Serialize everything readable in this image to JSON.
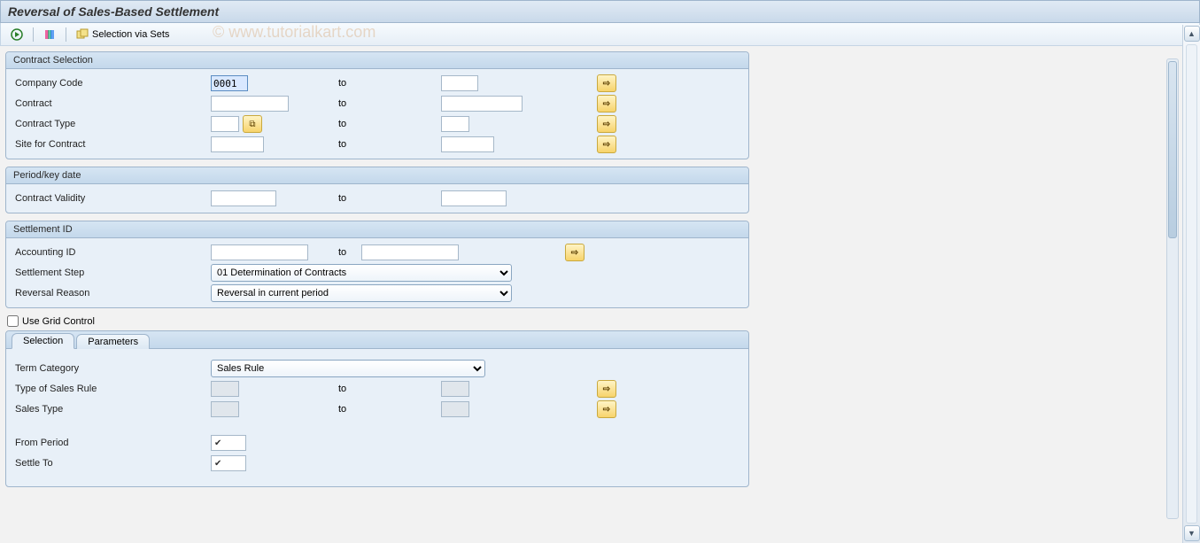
{
  "title": "Reversal of Sales-Based Settlement",
  "toolbar": {
    "execute_tip": "Execute",
    "variant_tip": "Get Variant",
    "selection_via_sets_label": "Selection via Sets"
  },
  "watermark": "© www.tutorialkart.com",
  "groups": {
    "contract_selection": {
      "title": "Contract Selection",
      "company_code_label": "Company Code",
      "company_code_from": "0001",
      "company_code_to": "",
      "contract_label": "Contract",
      "contract_from": "",
      "contract_to": "",
      "contract_type_label": "Contract Type",
      "contract_type_from": "",
      "contract_type_to": "",
      "site_label": "Site for Contract",
      "site_from": "",
      "site_to": "",
      "to_label": "to"
    },
    "period": {
      "title": "Period/key date",
      "contract_validity_label": "Contract Validity",
      "contract_validity_from": "",
      "contract_validity_to": "",
      "to_label": "to"
    },
    "settlement_id": {
      "title": "Settlement ID",
      "accounting_id_label": "Accounting ID",
      "accounting_id_from": "",
      "accounting_id_to": "",
      "to_label": "to",
      "settlement_step_label": "Settlement Step",
      "settlement_step_value": "01 Determination of Contracts",
      "reversal_reason_label": "Reversal Reason",
      "reversal_reason_value": "Reversal in current period"
    }
  },
  "use_grid_control_label": "Use Grid Control",
  "use_grid_control_checked": false,
  "tabs": {
    "selection_label": "Selection",
    "parameters_label": "Parameters",
    "active": "selection"
  },
  "tab_selection": {
    "term_category_label": "Term Category",
    "term_category_value": "Sales Rule",
    "type_of_sales_rule_label": "Type of Sales Rule",
    "type_of_sales_rule_from": "",
    "type_of_sales_rule_to": "",
    "sales_type_label": "Sales Type",
    "sales_type_from": "",
    "sales_type_to": "",
    "to_label": "to",
    "from_period_label": "From Period",
    "settle_to_label": "Settle To"
  }
}
